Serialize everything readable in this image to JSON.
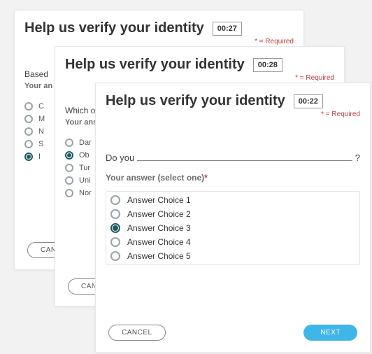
{
  "required_note": "* = Required",
  "instruction_label": "Your answer (select one)",
  "buttons": {
    "cancel": "CANCEL",
    "next": "NEXT"
  },
  "card_a": {
    "title": "Help us verify your identity",
    "timer": "00:27",
    "q_hint": "Based",
    "instr_hint": "Your an",
    "options": [
      {
        "label": "C",
        "selected": false
      },
      {
        "label": "M",
        "selected": false
      },
      {
        "label": "N",
        "selected": false
      },
      {
        "label": "S",
        "selected": false
      },
      {
        "label": "I",
        "selected": true
      }
    ]
  },
  "card_b": {
    "title": "Help us verify your identity",
    "timer": "00:28",
    "q_hint": "Which of",
    "instr_hint": "Your ans",
    "options": [
      {
        "label": "Dar",
        "selected": false
      },
      {
        "label": "Ob",
        "selected": true
      },
      {
        "label": "Tur",
        "selected": false
      },
      {
        "label": "Uni",
        "selected": false
      },
      {
        "label": "Nor",
        "selected": false
      }
    ]
  },
  "card_c": {
    "title": "Help us verify your identity",
    "timer": "00:22",
    "question_lead": "Do you",
    "question_mark": "?",
    "options": [
      {
        "label": "Answer Choice 1",
        "selected": false
      },
      {
        "label": "Answer Choice 2",
        "selected": false
      },
      {
        "label": "Answer Choice 3",
        "selected": true
      },
      {
        "label": "Answer Choice 4",
        "selected": false
      },
      {
        "label": "Answer Choice 5",
        "selected": false
      }
    ]
  }
}
